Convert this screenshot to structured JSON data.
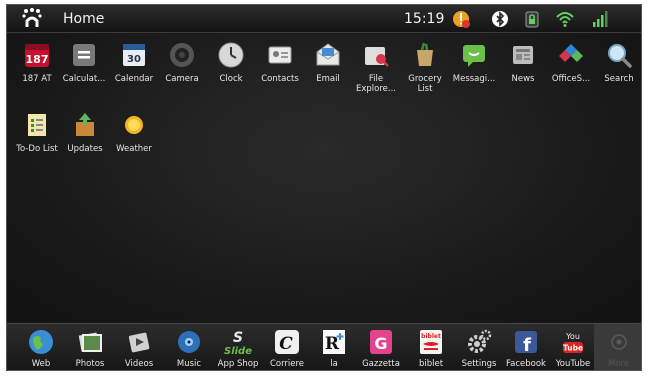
{
  "status_bar": {
    "title": "Home",
    "time": "15:19"
  },
  "apps": [
    {
      "label": "187 AT",
      "icon": "calendar-187-icon"
    },
    {
      "label": "Calculat...",
      "icon": "calculator-icon"
    },
    {
      "label": "Calendar",
      "icon": "calendar-icon"
    },
    {
      "label": "Camera",
      "icon": "camera-icon"
    },
    {
      "label": "Clock",
      "icon": "clock-icon"
    },
    {
      "label": "Contacts",
      "icon": "contacts-icon"
    },
    {
      "label": "Email",
      "icon": "email-icon"
    },
    {
      "label": "File Explore...",
      "icon": "file-explorer-icon"
    },
    {
      "label": "Grocery List",
      "icon": "grocery-list-icon"
    },
    {
      "label": "Messagi...",
      "icon": "messaging-icon"
    },
    {
      "label": "News",
      "icon": "news-icon"
    },
    {
      "label": "OfficeS...",
      "icon": "office-suite-icon"
    },
    {
      "label": "Search",
      "icon": "search-icon"
    },
    {
      "label": "To-Do List",
      "icon": "todo-list-icon"
    },
    {
      "label": "Updates",
      "icon": "updates-icon"
    },
    {
      "label": "Weather",
      "icon": "weather-icon"
    }
  ],
  "dock": [
    {
      "label": "Web",
      "icon": "globe-icon"
    },
    {
      "label": "Photos",
      "icon": "photos-icon"
    },
    {
      "label": "Videos",
      "icon": "videos-icon"
    },
    {
      "label": "Music",
      "icon": "music-icon"
    },
    {
      "label": "App Shop",
      "icon": "app-shop-icon"
    },
    {
      "label": "Corriere",
      "icon": "corriere-icon"
    },
    {
      "label": "la",
      "icon": "la-repubblica-icon"
    },
    {
      "label": "Gazzetta",
      "icon": "gazzetta-icon"
    },
    {
      "label": "biblet",
      "icon": "biblet-icon"
    },
    {
      "label": "Settings",
      "icon": "settings-icon"
    },
    {
      "label": "Facebook",
      "icon": "facebook-icon"
    },
    {
      "label": "YouTube",
      "icon": "youtube-icon"
    },
    {
      "label": "More",
      "icon": "more-icon"
    }
  ],
  "icon_texts": {
    "cal187": "187",
    "cal30": "30",
    "slide": "Slide",
    "corriere": "C",
    "repubblica": "R",
    "gazzetta": "G",
    "biblet": "biblet",
    "facebook": "f",
    "youtube_top": "You",
    "youtube_bottom": "Tube"
  },
  "colors": {
    "background": "#1a1a1a",
    "label": "#e6e6e6",
    "wifi": "#5fd35f",
    "alert": "#f0a020"
  }
}
